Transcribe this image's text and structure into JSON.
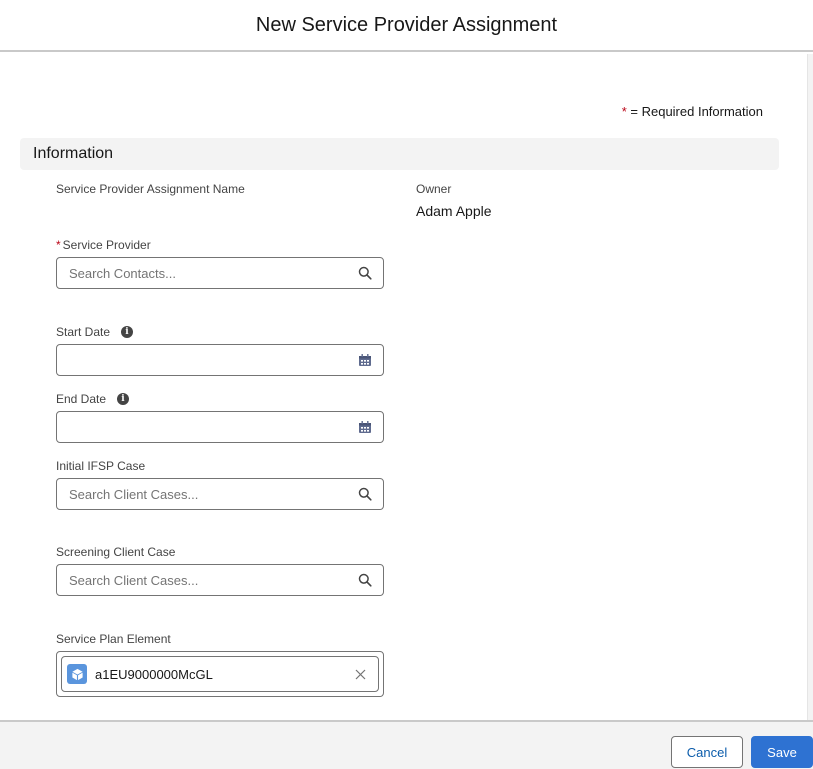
{
  "modal": {
    "title": "New Service Provider Assignment",
    "required_star": "*",
    "required_note": "= Required Information"
  },
  "section": {
    "title": "Information"
  },
  "fields": {
    "name": {
      "label": "Service Provider Assignment Name"
    },
    "owner": {
      "label": "Owner",
      "value": "Adam Apple"
    },
    "service_provider": {
      "label": "Service Provider",
      "required": "*",
      "placeholder": "Search Contacts...",
      "icon": "search-icon"
    },
    "start_date": {
      "label": "Start Date",
      "info_icon": "i",
      "value": "",
      "icon": "calendar-icon"
    },
    "end_date": {
      "label": "End Date",
      "info_icon": "i",
      "value": "",
      "icon": "calendar-icon"
    },
    "initial_ifsp_case": {
      "label": "Initial IFSP Case",
      "placeholder": "Search Client Cases...",
      "icon": "search-icon"
    },
    "screening_client_case": {
      "label": "Screening Client Case",
      "placeholder": "Search Client Cases...",
      "icon": "search-icon"
    },
    "service_plan_element": {
      "label": "Service Plan Element",
      "selected": "a1EU9000000McGL",
      "icon": "object-cube-icon"
    }
  },
  "footer": {
    "cancel_label": "Cancel",
    "save_label": "Save"
  },
  "colors": {
    "brand": "#2e72d2",
    "required": "#ba0517",
    "object_icon": "#5a95dd"
  }
}
